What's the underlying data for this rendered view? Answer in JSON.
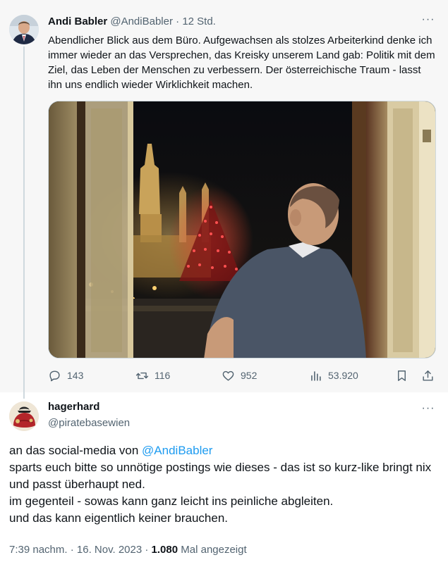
{
  "parent_tweet": {
    "author_name": "Andi Babler",
    "handle": "@AndiBabler",
    "separator": " · ",
    "time": "12 Std.",
    "text": "Abendlicher Blick aus dem Büro. Aufgewachsen als stolzes Arbeiterkind denke ich immer wieder an das Versprechen, das Kreisky unserem Land gab: Politik mit dem Ziel, das Leben der Menschen zu verbessern. Der österreichische Traum - lasst ihn uns endlich wieder Wirklichkeit machen.",
    "stats": {
      "replies": "143",
      "reposts": "116",
      "likes": "952",
      "views": "53.920"
    }
  },
  "reply_tweet": {
    "author_name": "hagerhard",
    "handle": "@piratebasewien",
    "mention": "@AndiBabler",
    "line1_prefix": "an das social-media von ",
    "line2": "sparts euch bitte so unnötige postings wie dieses - das ist so kurz-like bringt nix und passt überhaupt ned.",
    "line3": "im gegenteil - sowas kann ganz leicht ins peinliche abgleiten.",
    "line4": "und das kann eigentlich keiner brauchen.",
    "time": "7:39 nachm.",
    "date": "16. Nov. 2023",
    "separator": " · ",
    "views_count": "1.080",
    "views_label": " Mal angezeigt"
  },
  "icons": {
    "more": "more-icon",
    "reply": "reply-icon",
    "repost": "repost-icon",
    "like": "heart-icon",
    "views": "analytics-icon",
    "bookmark": "bookmark-icon",
    "share": "share-icon"
  },
  "colors": {
    "link": "#1d9bf0",
    "secondary_text": "#536471",
    "parent_background": "#f7f7f7"
  }
}
